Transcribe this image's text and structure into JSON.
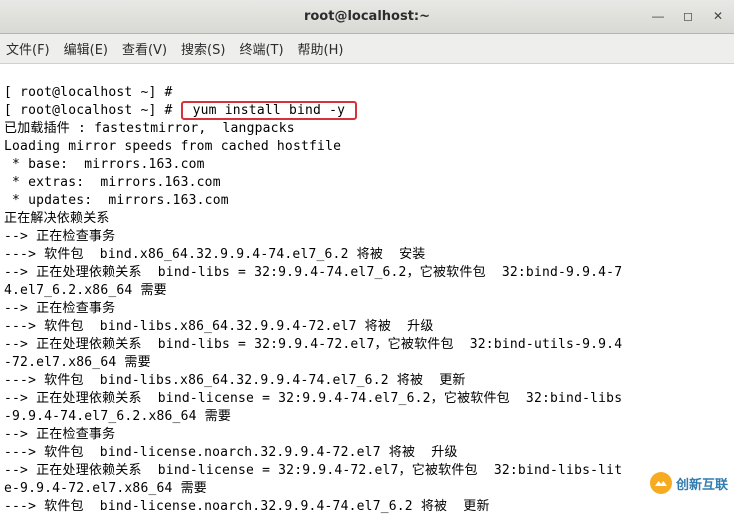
{
  "window": {
    "title": "root@localhost:~"
  },
  "menu": {
    "file": "文件(F)",
    "edit": "编辑(E)",
    "view": "查看(V)",
    "search": "搜索(S)",
    "terminal": "终端(T)",
    "help": "帮助(H)"
  },
  "prompt": {
    "line1_pre": "[ root@localhost ~] # ",
    "line2_pre": "[ root@localhost ~] # ",
    "command_highlighted": " yum install bind -y "
  },
  "output": {
    "l01": "已加载插件 : fastestmirror,  langpacks",
    "l02": "Loading mirror speeds from cached hostfile",
    "l03": " * base:  mirrors.163.com",
    "l04": " * extras:  mirrors.163.com",
    "l05": " * updates:  mirrors.163.com",
    "l06": "正在解决依赖关系",
    "l07": "--> 正在检查事务",
    "l08": "---> 软件包  bind.x86_64.32.9.9.4-74.el7_6.2 将被  安装",
    "l09": "--> 正在处理依赖关系  bind-libs = 32:9.9.4-74.el7_6.2，它被软件包  32:bind-9.9.4-7",
    "l10": "4.el7_6.2.x86_64 需要",
    "l11": "--> 正在检查事务",
    "l12": "---> 软件包  bind-libs.x86_64.32.9.9.4-72.el7 将被  升级",
    "l13": "--> 正在处理依赖关系  bind-libs = 32:9.9.4-72.el7，它被软件包  32:bind-utils-9.9.4",
    "l14": "-72.el7.x86_64 需要",
    "l15": "---> 软件包  bind-libs.x86_64.32.9.9.4-74.el7_6.2 将被  更新",
    "l16": "--> 正在处理依赖关系  bind-license = 32:9.9.4-74.el7_6.2，它被软件包  32:bind-libs",
    "l17": "-9.9.4-74.el7_6.2.x86_64 需要",
    "l18": "--> 正在检查事务",
    "l19": "---> 软件包  bind-license.noarch.32.9.9.4-72.el7 将被  升级",
    "l20": "--> 正在处理依赖关系  bind-license = 32:9.9.4-72.el7，它被软件包  32:bind-libs-lit",
    "l21": "e-9.9.4-72.el7.x86_64 需要",
    "l22": "---> 软件包  bind-license.noarch.32.9.9.4-74.el7_6.2 将被  更新"
  },
  "watermark": {
    "text": "创新互联"
  },
  "highlight_color": "#d7323c"
}
